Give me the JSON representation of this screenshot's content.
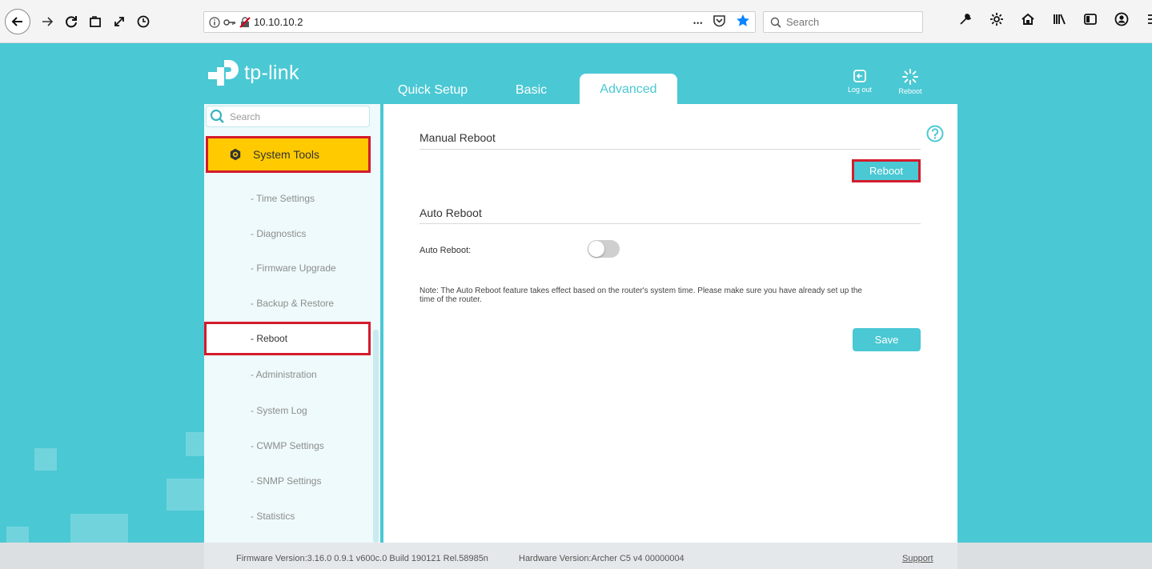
{
  "browser": {
    "url": "10.10.10.2",
    "search_placeholder": "Search",
    "more_glyph": "•••"
  },
  "header": {
    "logo_text": "tp-link",
    "tabs": [
      {
        "label": "Quick Setup"
      },
      {
        "label": "Basic"
      },
      {
        "label": "Advanced"
      }
    ],
    "logout_label": "Log out",
    "reboot_label": "Reboot"
  },
  "sidebar": {
    "search_placeholder": "Search",
    "section_title": "System Tools",
    "items": [
      {
        "label": "- Time Settings"
      },
      {
        "label": "- Diagnostics"
      },
      {
        "label": "- Firmware Upgrade"
      },
      {
        "label": "- Backup & Restore"
      },
      {
        "label": "- Reboot"
      },
      {
        "label": "- Administration"
      },
      {
        "label": "- System Log"
      },
      {
        "label": "- CWMP Settings"
      },
      {
        "label": "- SNMP Settings"
      },
      {
        "label": "- Statistics"
      }
    ]
  },
  "main": {
    "manual_title": "Manual Reboot",
    "reboot_button": "Reboot",
    "auto_title": "Auto Reboot",
    "auto_label": "Auto Reboot:",
    "auto_enabled": false,
    "note_line1": "Note: The Auto Reboot feature takes effect based on the router's system time. Please make sure you have already set up the",
    "note_line2": "time of the router.",
    "save_button": "Save"
  },
  "footer": {
    "firmware": "Firmware Version:3.16.0 0.9.1 v600c.0 Build 190121 Rel.58985n",
    "hardware": "Hardware Version:Archer C5 v4 00000004",
    "support": "Support"
  },
  "colors": {
    "accent": "#4ac8d4",
    "highlight": "#ffca00",
    "annotation_red": "#d31c2c"
  }
}
